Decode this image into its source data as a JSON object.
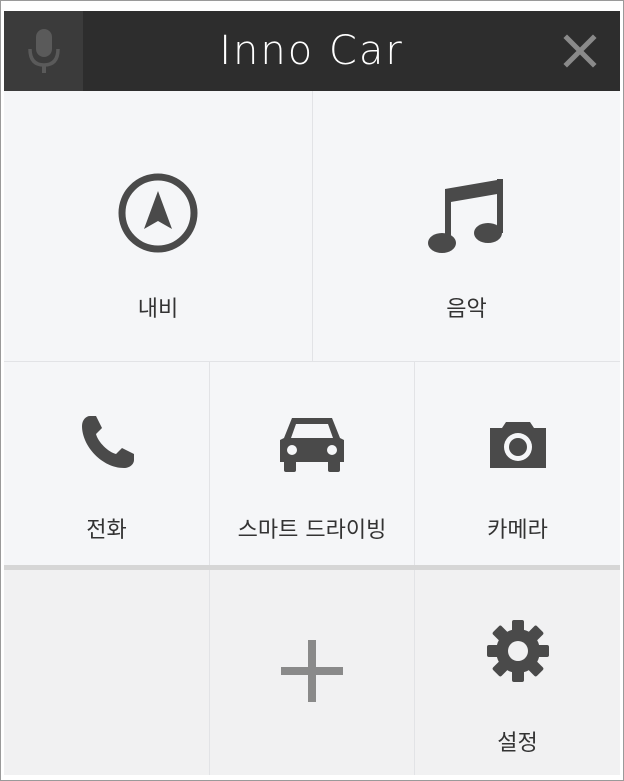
{
  "header": {
    "title": "Inno Car",
    "mic_icon": "microphone-icon",
    "close_icon": "close-icon"
  },
  "tiles": {
    "navi": {
      "label": "내비",
      "icon": "navigation-arrow-icon"
    },
    "music": {
      "label": "음악",
      "icon": "music-note-icon"
    },
    "phone": {
      "label": "전화",
      "icon": "phone-icon"
    },
    "smart_drive": {
      "label": "스마트 드라이빙",
      "icon": "car-icon"
    },
    "camera": {
      "label": "카메라",
      "icon": "camera-icon"
    },
    "add": {
      "icon": "plus-icon"
    },
    "settings": {
      "label": "설정",
      "icon": "gear-icon"
    }
  },
  "colors": {
    "header_bg": "#2d2d2d",
    "icon": "#4a4a4a",
    "tile_bg": "#f5f6f8"
  }
}
